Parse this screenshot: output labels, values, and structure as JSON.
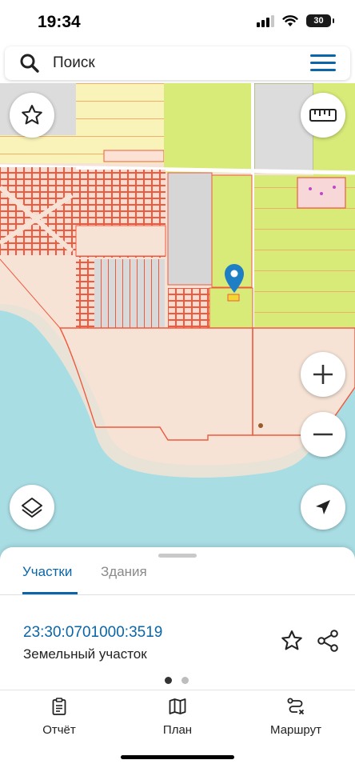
{
  "status_bar": {
    "time": "19:34",
    "battery": "30"
  },
  "search": {
    "placeholder": "Поиск"
  },
  "map": {
    "icons": [
      "favorite-star-icon",
      "ruler-icon",
      "zoom-in-icon",
      "zoom-out-icon",
      "layers-icon",
      "location-arrow-icon"
    ],
    "colors": {
      "water": "#a6dde4",
      "parcel_outline": "#f2553a",
      "agricultural": "#dbe97a",
      "residential": "#f8ecd8",
      "built": "#cfcfcf"
    }
  },
  "sheet": {
    "tabs": [
      {
        "label": "Участки",
        "active": true
      },
      {
        "label": "Здания",
        "active": false
      }
    ],
    "parcel": {
      "cadastral_number": "23:30:0701000:3519",
      "type": "Земельный участок"
    },
    "page_count": 2,
    "active_page": 1
  },
  "bottom_nav": [
    {
      "label": "Отчёт",
      "icon": "report-clipboard-icon"
    },
    {
      "label": "План",
      "icon": "map-plan-icon"
    },
    {
      "label": "Маршрут",
      "icon": "route-icon"
    }
  ],
  "colors": {
    "accent": "#0a66a8"
  }
}
